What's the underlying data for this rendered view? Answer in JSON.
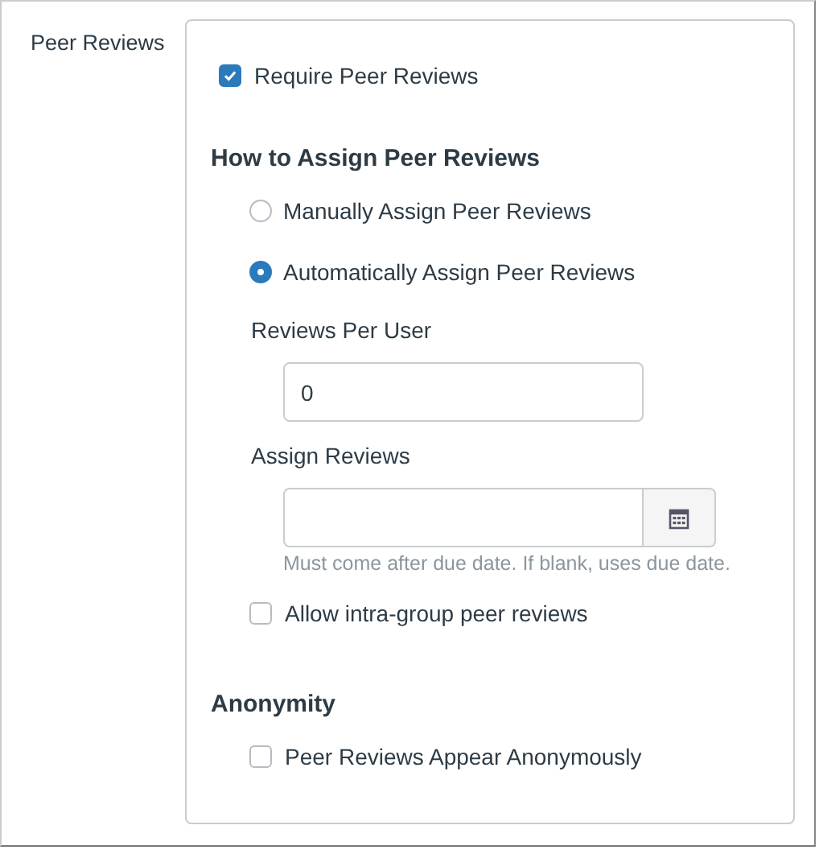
{
  "label": "Peer Reviews",
  "require": {
    "label": "Require Peer Reviews",
    "checked": true
  },
  "assign_heading": "How to Assign Peer Reviews",
  "assign_options": [
    {
      "label": "Manually Assign Peer Reviews",
      "selected": false
    },
    {
      "label": "Automatically Assign Peer Reviews",
      "selected": true
    }
  ],
  "reviews_per_user": {
    "label": "Reviews Per User",
    "value": "0"
  },
  "assign_reviews": {
    "label": "Assign Reviews",
    "hint": "Must come after due date. If blank, uses due date."
  },
  "intra_group": {
    "label": "Allow intra-group peer reviews",
    "checked": false
  },
  "anonymity_heading": "Anonymity",
  "anonymous": {
    "label": "Peer Reviews Appear Anonymously",
    "checked": false
  }
}
